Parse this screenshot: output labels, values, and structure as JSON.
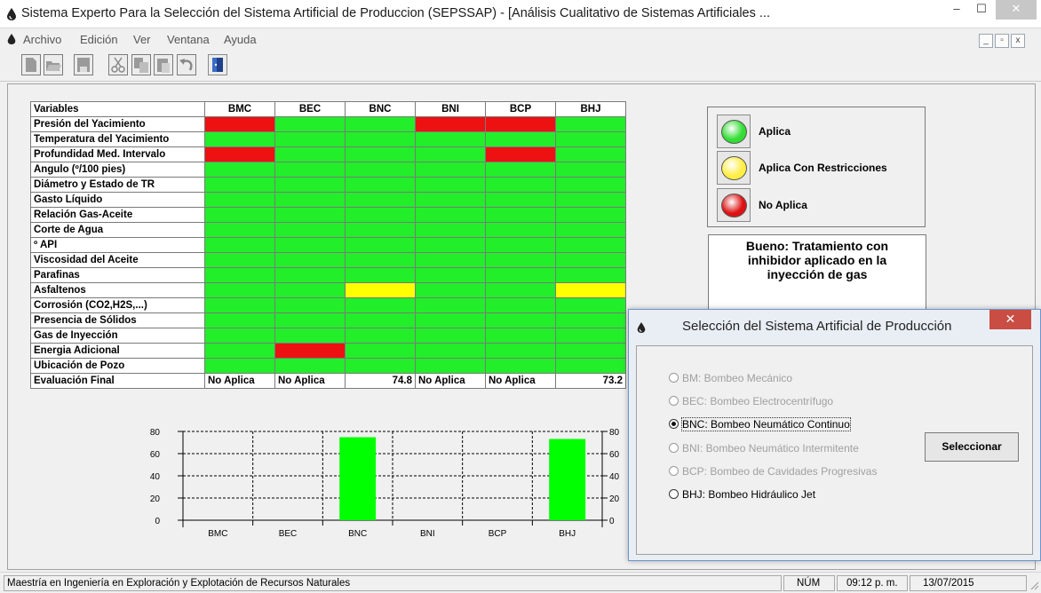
{
  "window": {
    "title": "Sistema Experto Para la Selección del Sistema Artificial de Produccion (SEPSSAP) - [Análisis Cualitativo de Sistemas Artificiales ...",
    "minimize": "–",
    "maximize": "☐",
    "close": "✕"
  },
  "menu": {
    "items": [
      "Archivo",
      "Edición",
      "Ver",
      "Ventana",
      "Ayuda"
    ],
    "mdi_min": "_",
    "mdi_restore": "▫",
    "mdi_close": "x"
  },
  "toolbar": {
    "icons": [
      "new-icon",
      "open-icon",
      "save-icon",
      "cut-icon",
      "copy-icon",
      "paste-icon",
      "undo-icon",
      "exit-icon"
    ]
  },
  "table": {
    "header": [
      "Variables",
      "BMC",
      "BEC",
      "BNC",
      "BNI",
      "BCP",
      "BHJ"
    ],
    "rows": [
      {
        "name": "Presión del Yacimiento",
        "cells": [
          "red",
          "green",
          "green",
          "red",
          "red",
          "green"
        ]
      },
      {
        "name": "Temperatura del Yacimiento",
        "cells": [
          "green",
          "green",
          "green",
          "green",
          "green",
          "green"
        ]
      },
      {
        "name": "Profundidad Med. Intervalo",
        "cells": [
          "red",
          "green",
          "green",
          "green",
          "red",
          "green"
        ]
      },
      {
        "name": "Angulo (º/100 pies)",
        "cells": [
          "green",
          "green",
          "green",
          "green",
          "green",
          "green"
        ]
      },
      {
        "name": "Diámetro y Estado de TR",
        "cells": [
          "green",
          "green",
          "green",
          "green",
          "green",
          "green"
        ]
      },
      {
        "name": "Gasto Líquido",
        "cells": [
          "green",
          "green",
          "green",
          "green",
          "green",
          "green"
        ]
      },
      {
        "name": "Relación Gas-Aceite",
        "cells": [
          "green",
          "green",
          "green",
          "green",
          "green",
          "green"
        ]
      },
      {
        "name": "Corte de Agua",
        "cells": [
          "green",
          "green",
          "green",
          "green",
          "green",
          "green"
        ]
      },
      {
        "name": "º API",
        "cells": [
          "green",
          "green",
          "green",
          "green",
          "green",
          "green"
        ]
      },
      {
        "name": "Viscosidad del Aceite",
        "cells": [
          "green",
          "green",
          "green",
          "green",
          "green",
          "green"
        ]
      },
      {
        "name": "Parafinas",
        "cells": [
          "green",
          "green",
          "green",
          "green",
          "green",
          "green"
        ]
      },
      {
        "name": "Asfaltenos",
        "cells": [
          "green",
          "green",
          "yellow",
          "green",
          "green",
          "yellow"
        ]
      },
      {
        "name": "Corrosión (CO2,H2S,...)",
        "cells": [
          "green",
          "green",
          "green",
          "green",
          "green",
          "green"
        ]
      },
      {
        "name": "Presencia de Sólidos",
        "cells": [
          "green",
          "green",
          "green",
          "green",
          "green",
          "green"
        ]
      },
      {
        "name": "Gas de Inyección",
        "cells": [
          "green",
          "green",
          "green",
          "green",
          "green",
          "green"
        ]
      },
      {
        "name": "Energia Adicional",
        "cells": [
          "green",
          "red",
          "green",
          "green",
          "green",
          "green"
        ]
      },
      {
        "name": "Ubicación de Pozo",
        "cells": [
          "green",
          "green",
          "green",
          "green",
          "green",
          "green"
        ]
      }
    ],
    "final_label": "Evaluación Final",
    "final_values": [
      "No Aplica",
      "No Aplica",
      "74.8",
      "No Aplica",
      "No Aplica",
      "73.2"
    ],
    "colors": {
      "green": "#22ee2a",
      "red": "#ee1111",
      "yellow": "#ffff00"
    }
  },
  "legend": {
    "items": [
      {
        "label": "Aplica",
        "color": "#33dd33"
      },
      {
        "label": "Aplica Con Restricciones",
        "color": "#ffee44"
      },
      {
        "label": "No Aplica",
        "color": "#dd1111"
      }
    ]
  },
  "comment": {
    "lines": [
      "Bueno: Tratamiento con",
      "inhibidor aplicado en la",
      "inyección de gas"
    ]
  },
  "chart_data": {
    "type": "bar",
    "categories": [
      "BMC",
      "BEC",
      "BNC",
      "BNI",
      "BCP",
      "BHJ"
    ],
    "values": [
      0,
      0,
      74.8,
      0,
      0,
      73.2
    ],
    "ylim": [
      0,
      80
    ],
    "yticks": [
      "0",
      "20",
      "40",
      "60",
      "80"
    ],
    "bar_color": "#00ff00",
    "grid": true
  },
  "dialog": {
    "title": "Selección del Sistema Artificial de Producción",
    "close": "✕",
    "options": [
      {
        "label": "BM: Bombeo Mecánico",
        "enabled": false,
        "selected": false
      },
      {
        "label": "BEC: Bombeo Electrocentrífugo",
        "enabled": false,
        "selected": false
      },
      {
        "label": "BNC: Bombeo Neumático Continuo",
        "enabled": true,
        "selected": true
      },
      {
        "label": "BNI: Bombeo Neumático Intermitente",
        "enabled": false,
        "selected": false
      },
      {
        "label": "BCP: Bombeo de Cavidades Progresivas",
        "enabled": false,
        "selected": false
      },
      {
        "label": "BHJ: Bombeo Hidráulico Jet",
        "enabled": true,
        "selected": false
      }
    ],
    "button": "Seleccionar"
  },
  "status": {
    "message": "Maestría en Ingeniería en Exploración y Explotación de Recursos Naturales",
    "num": "NÚM",
    "time": "09:12 p. m.",
    "date": "13/07/2015"
  }
}
